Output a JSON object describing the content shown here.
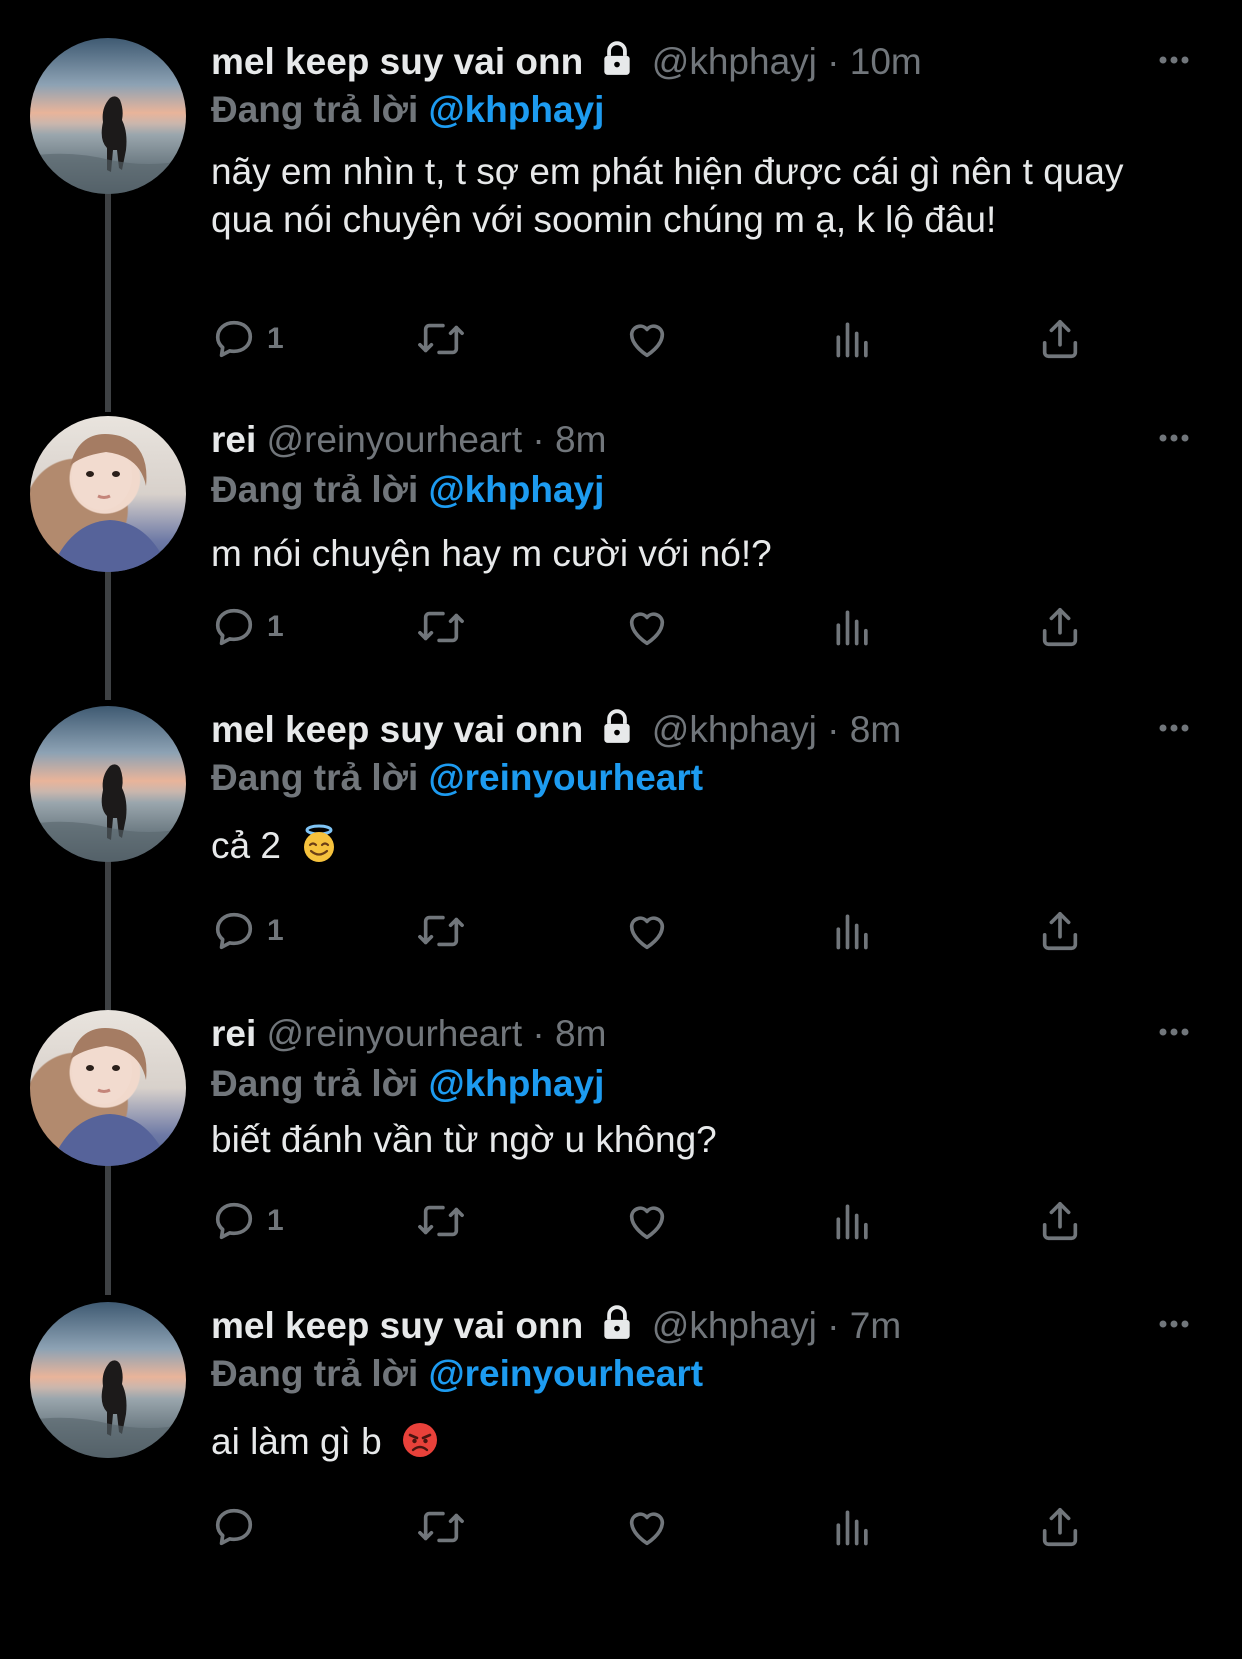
{
  "tweets": [
    {
      "name": "mel keep suy vai onn",
      "locked": true,
      "handle": "@khphayj",
      "dot": "·",
      "time": "10m",
      "reply_label": "Đang trả lời",
      "reply_to": "@khphayj",
      "text": "nãy em nhìn t, t sợ em phát hiện được cái gì nên t quay qua nói chuyện với soomin chúng m ạ, k lộ đâu!",
      "reply_count": "1",
      "avatar": "sunset-silhouette"
    },
    {
      "name": "rei",
      "locked": false,
      "handle": "@reinyourheart",
      "dot": "·",
      "time": "8m",
      "reply_label": "Đang trả lời",
      "reply_to": "@khphayj",
      "text": "m nói chuyện hay m cười với nó!?",
      "reply_count": "1",
      "avatar": "girl-portrait"
    },
    {
      "name": "mel keep suy vai onn",
      "locked": true,
      "handle": "@khphayj",
      "dot": "·",
      "time": "8m",
      "reply_label": "Đang trả lời",
      "reply_to": "@reinyourheart",
      "text": "cả 2",
      "emoji": "smiling-face-with-halo",
      "reply_count": "1",
      "avatar": "sunset-silhouette"
    },
    {
      "name": "rei",
      "locked": false,
      "handle": "@reinyourheart",
      "dot": "·",
      "time": "8m",
      "reply_label": "Đang trả lời",
      "reply_to": "@khphayj",
      "text": "biết đánh vần từ ngờ u không?",
      "reply_count": "1",
      "avatar": "girl-portrait"
    },
    {
      "name": "mel keep suy vai onn",
      "locked": true,
      "handle": "@khphayj",
      "dot": "·",
      "time": "7m",
      "reply_label": "Đang trả lời",
      "reply_to": "@reinyourheart",
      "text": "ai làm gì b",
      "emoji": "angry-face",
      "reply_count": "",
      "avatar": "sunset-silhouette"
    }
  ],
  "colors": {
    "background": "#000000",
    "text": "#e7e9ea",
    "muted": "#71767b",
    "mention": "#1d9bf0",
    "thread_line": "#3e4144"
  },
  "icons": [
    "reply-icon",
    "retweet-icon",
    "like-icon",
    "views-icon",
    "share-icon",
    "more-icon",
    "lock-icon"
  ]
}
